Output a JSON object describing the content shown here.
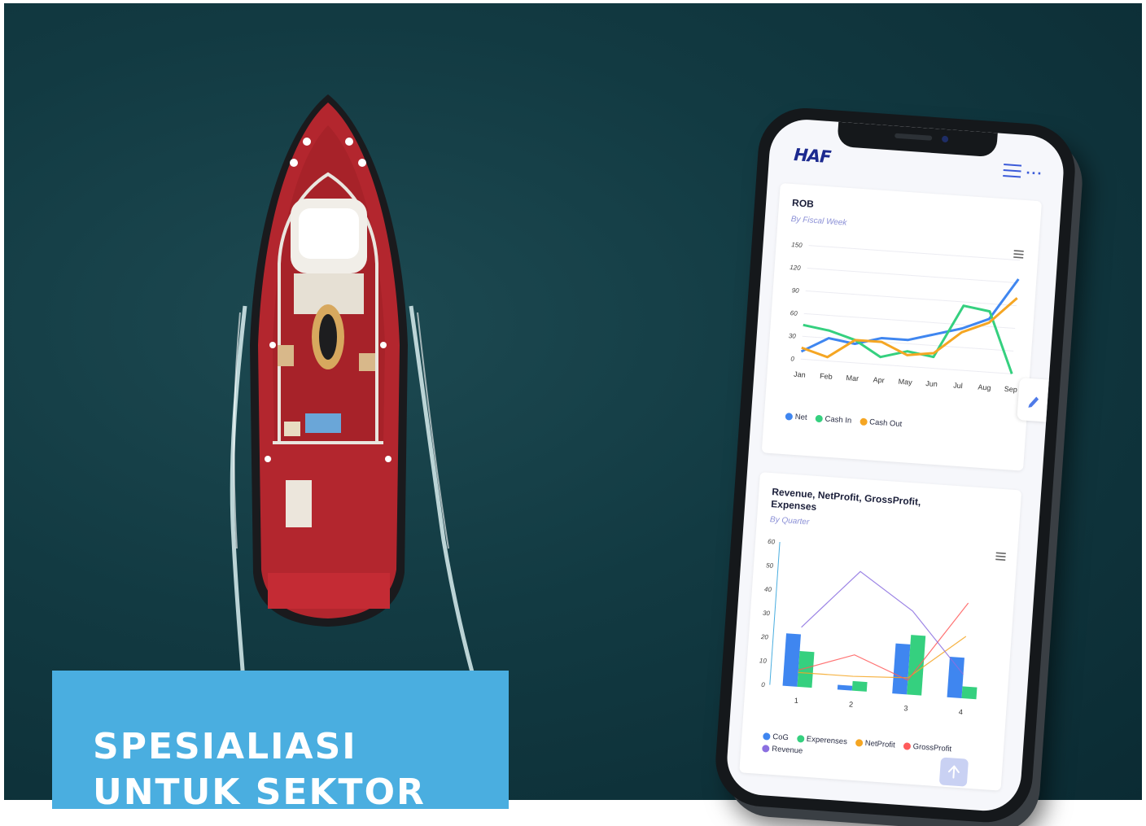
{
  "banner": {
    "text": "SPESIALIASI UNTUK SEKTOR"
  },
  "app": {
    "logo": "HAF",
    "more_label": "···"
  },
  "charts": [
    {
      "title": "ROB",
      "subtitle": "By Fiscal Week"
    },
    {
      "title": "Revenue, NetProfit, GrossProfit, Expenses",
      "subtitle": "By Quarter"
    }
  ],
  "colors": {
    "banner_bg": "#4aaee0",
    "sea": "#123a42",
    "boat_hull": "#b3262e",
    "net": "#3f86f0",
    "cash_in": "#35d07f",
    "cash_out": "#f5a623",
    "cog": "#3f86f0",
    "experenses": "#35d07f",
    "net_profit": "#f5a623",
    "gross_profit": "#ff5b5b",
    "revenue": "#8b6fe0"
  },
  "icons": [
    "hamburger-menu-icon",
    "more-dots-icon",
    "pencil-icon",
    "chart-menu-icon",
    "arrow-up-icon"
  ],
  "chart_data": [
    {
      "type": "line",
      "title": "ROB",
      "subtitle": "By Fiscal Week",
      "categories": [
        "Jan",
        "Feb",
        "Mar",
        "Apr",
        "May",
        "Jun",
        "Jul",
        "Aug",
        "Sep"
      ],
      "ylim": [
        0,
        150
      ],
      "yticks": [
        "150",
        "120",
        "90",
        "60",
        "30",
        "0"
      ],
      "series": [
        {
          "name": "Net",
          "values": [
            10,
            30,
            25,
            35,
            35,
            45,
            55,
            70,
            125
          ]
        },
        {
          "name": "Cash In",
          "values": [
            45,
            40,
            30,
            10,
            20,
            15,
            85,
            80,
            0
          ]
        },
        {
          "name": "Cash Out",
          "values": [
            15,
            5,
            30,
            30,
            15,
            20,
            50,
            65,
            100
          ]
        }
      ]
    },
    {
      "type": "bar",
      "title": "Revenue, NetProfit, GrossProfit, Expenses",
      "subtitle": "By Quarter",
      "categories": [
        "1",
        "2",
        "3",
        "4"
      ],
      "ylim": [
        0,
        60
      ],
      "yticks": [
        "60",
        "50",
        "40",
        "30",
        "20",
        "10",
        "0"
      ],
      "series": [
        {
          "name": "CoG",
          "type": "bar",
          "values": [
            22,
            2,
            21,
            17
          ]
        },
        {
          "name": "Experenses",
          "type": "bar",
          "values": [
            15,
            4,
            25,
            5
          ]
        },
        {
          "name": "NetProfit",
          "type": "line",
          "values": [
            6,
            6,
            7,
            26
          ]
        },
        {
          "name": "GrossProfit",
          "type": "line",
          "values": [
            7,
            15,
            6,
            40
          ]
        },
        {
          "name": "Revenue",
          "type": "line",
          "values": [
            25,
            50,
            35,
            10
          ]
        }
      ]
    }
  ]
}
